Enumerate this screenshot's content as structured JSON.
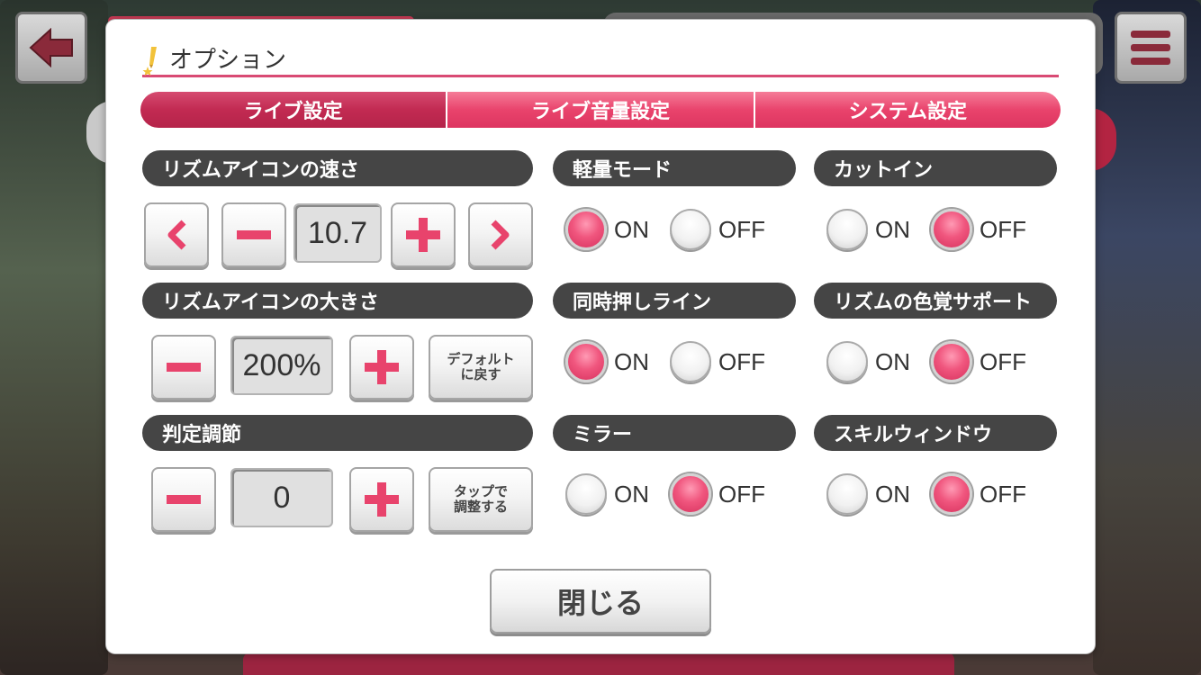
{
  "dialog": {
    "title": "オプション",
    "tabs": [
      "ライブ設定",
      "ライブ音量設定",
      "システム設定"
    ]
  },
  "rhythm_speed": {
    "label": "リズムアイコンの速さ",
    "value": "10.7"
  },
  "rhythm_size": {
    "label": "リズムアイコンの大きさ",
    "value": "200%",
    "default_label_line1": "デフォルト",
    "default_label_line2": "に戻す"
  },
  "timing": {
    "label": "判定調節",
    "value": "0",
    "tap_label_line1": "タップで",
    "tap_label_line2": "調整する"
  },
  "toggles": [
    {
      "label": "軽量モード",
      "selected": "ON"
    },
    {
      "label": "カットイン",
      "selected": "OFF"
    },
    {
      "label": "同時押しライン",
      "selected": "ON"
    },
    {
      "label": "リズムの色覚サポート",
      "selected": "OFF"
    },
    {
      "label": "ミラー",
      "selected": "OFF"
    },
    {
      "label": "スキルウィンドウ",
      "selected": "OFF"
    }
  ],
  "on_label": "ON",
  "off_label": "OFF",
  "close_label": "閉じる",
  "colors": {
    "accent": "#e9436c",
    "accent_dark": "#c22a52",
    "section_bg": "#454545",
    "radio_on": "#f0567e"
  }
}
